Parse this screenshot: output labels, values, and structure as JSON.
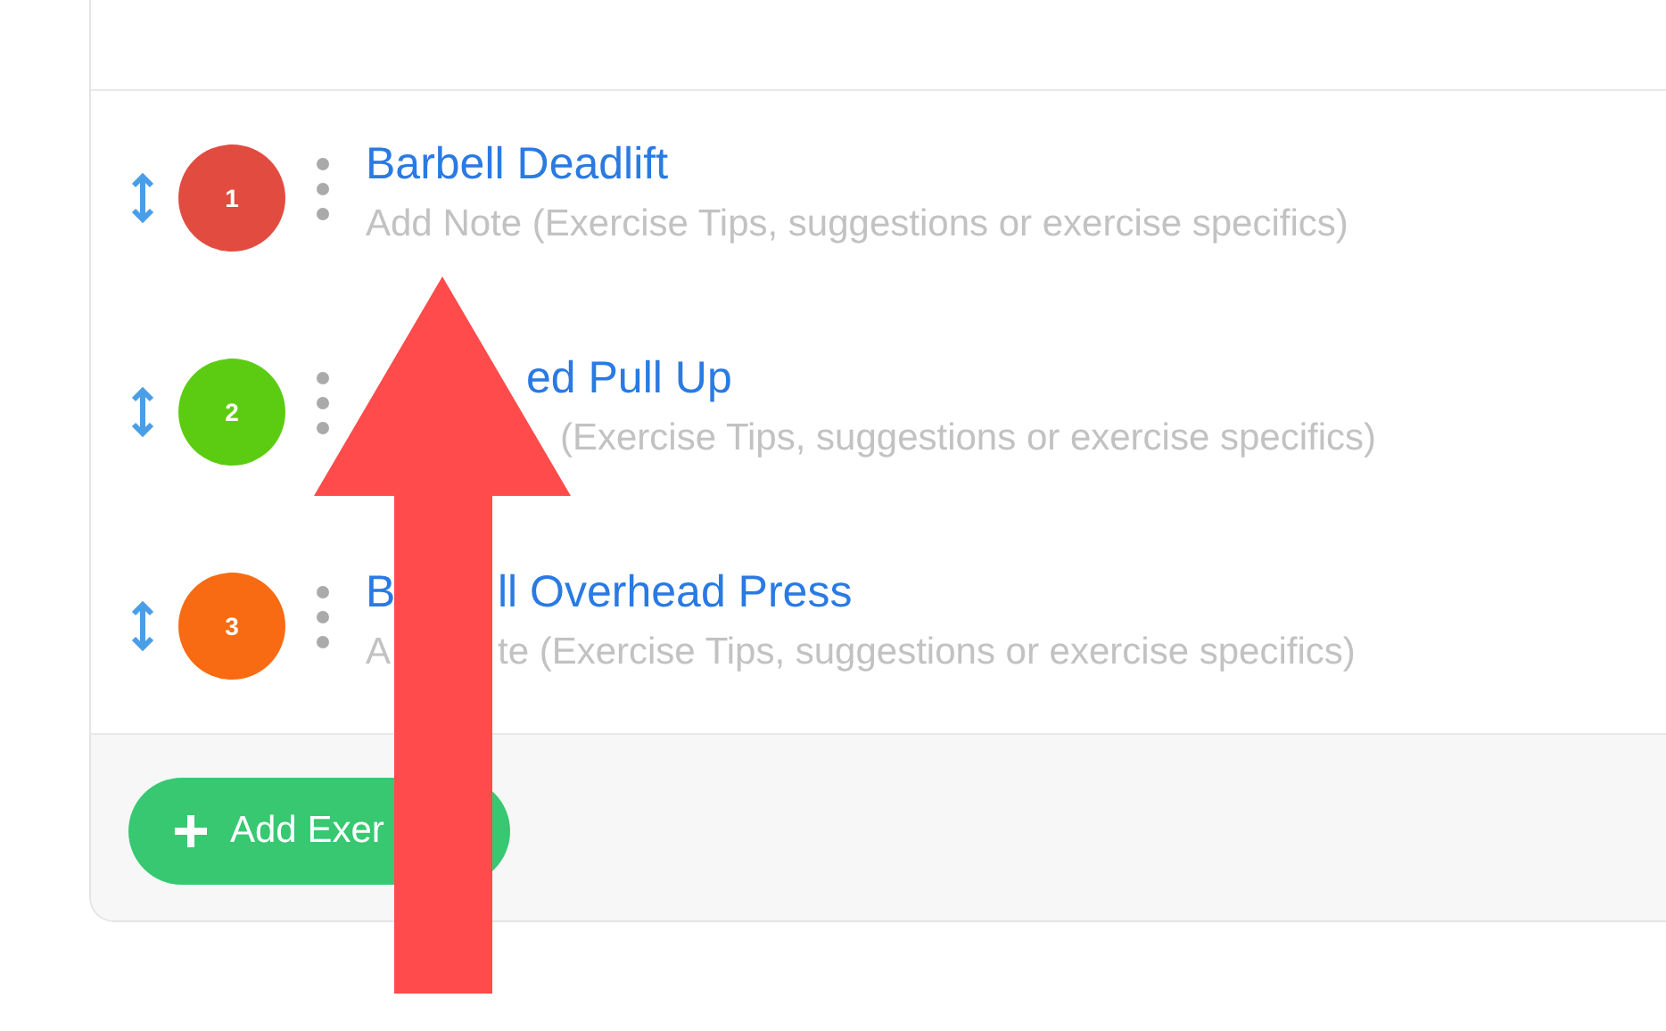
{
  "exercises": [
    {
      "number": "1",
      "color": "#e24c40",
      "name": [
        "Barbell Deadlift"
      ],
      "note_placeholder": [
        "Add Note (Exercise Tips, suggestions or exercise specifics)"
      ]
    },
    {
      "number": "2",
      "color": "#5ccc13",
      "name": [
        "ed Pull Up"
      ],
      "note_placeholder": [
        "(Exercise Tips, suggestions or exercise specifics)"
      ]
    },
    {
      "number": "3",
      "color": "#f86b12",
      "name": [
        "B",
        "ll Overhead Press"
      ],
      "note_placeholder": [
        "A",
        "te (Exercise Tips, suggestions or exercise specifics)"
      ]
    }
  ],
  "add_button": {
    "label": "Add Exer"
  }
}
